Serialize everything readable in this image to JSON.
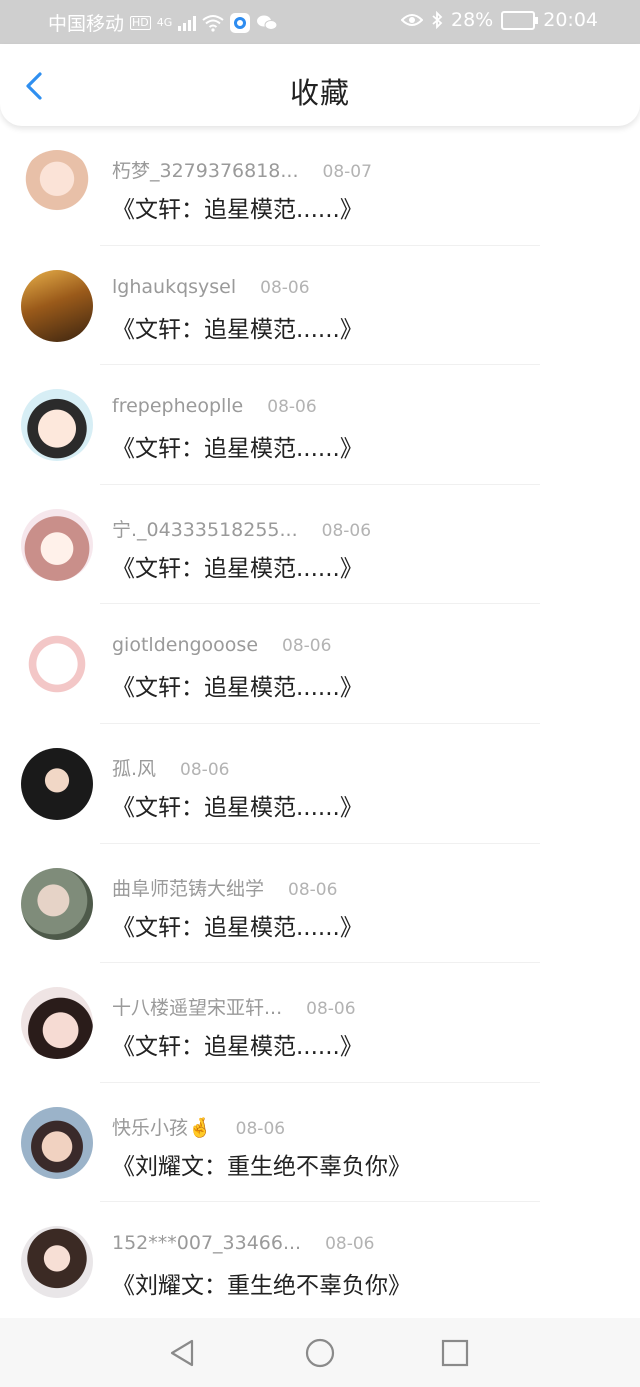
{
  "status_bar": {
    "carrier": "中国移动",
    "hd": "HD",
    "network": "4G",
    "battery_percent": "28%",
    "time": "20:04"
  },
  "header": {
    "title": "收藏",
    "back_icon": "chevron-left-icon",
    "accent_color": "#2f8ff0"
  },
  "items": [
    {
      "name": "朽梦_3279376818...",
      "date": "08-07",
      "title": "《文轩：追星模范......》",
      "avatar": "anime-girl-avatar"
    },
    {
      "name": "lghaukqsysel",
      "date": "08-06",
      "title": "《文轩：追星模范......》",
      "avatar": "autumn-forest-avatar"
    },
    {
      "name": "frepepheoplle",
      "date": "08-06",
      "title": "《文轩：追星模范......》",
      "avatar": "glasses-boy-avatar"
    },
    {
      "name": "宁._04333518255...",
      "date": "08-06",
      "title": "《文轩：追星模范......》",
      "avatar": "anime-girl-pink-avatar"
    },
    {
      "name": "giotldengooose",
      "date": "08-06",
      "title": "《文轩：追星模范......》",
      "avatar": "cartoon-girls-avatar"
    },
    {
      "name": "孤.风",
      "date": "08-06",
      "title": "《文轩：追星模范......》",
      "avatar": "cap-boy-avatar"
    },
    {
      "name": "曲阜师范铸大绌学",
      "date": "08-06",
      "title": "《文轩：追星模范......》",
      "avatar": "plush-bears-avatar"
    },
    {
      "name": "十八楼遥望宋亚轩...",
      "date": "08-06",
      "title": "《文轩：追星模范......》",
      "avatar": "boy-face-avatar"
    },
    {
      "name": "快乐小孩🤞",
      "date": "08-06",
      "title": "《刘耀文：重生绝不辜负你》",
      "avatar": "smiling-boy-avatar"
    },
    {
      "name": "152***007_33466...",
      "date": "08-06",
      "title": "《刘耀文：重生绝不辜负你》",
      "avatar": "girl-long-hair-avatar"
    }
  ],
  "system_nav": {
    "back": "triangle-back-icon",
    "home": "circle-home-icon",
    "recents": "square-recents-icon"
  }
}
